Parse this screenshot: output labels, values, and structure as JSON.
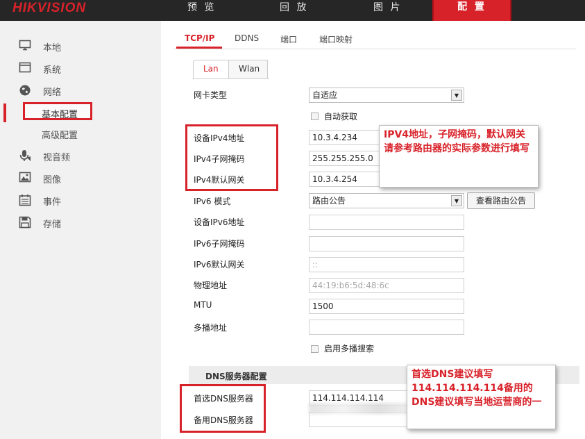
{
  "topbar": {
    "logo": "HIKVISION",
    "nav": [
      "预 览",
      "回 放",
      "图 片",
      "配 置"
    ]
  },
  "sidebar": {
    "items": [
      {
        "label": "本地",
        "icon": "monitor-icon"
      },
      {
        "label": "系统",
        "icon": "window-icon"
      },
      {
        "label": "网络",
        "icon": "globe-icon"
      },
      {
        "label": "基本配置",
        "icon": ""
      },
      {
        "label": "高级配置",
        "icon": ""
      },
      {
        "label": "视音频",
        "icon": "audio-video-icon"
      },
      {
        "label": "图像",
        "icon": "image-icon"
      },
      {
        "label": "事件",
        "icon": "calendar-icon"
      },
      {
        "label": "存储",
        "icon": "storage-icon"
      }
    ]
  },
  "tabs": [
    "TCP/IP",
    "DDNS",
    "端口",
    "端口映射"
  ],
  "subtabs": [
    "Lan",
    "Wlan"
  ],
  "form": {
    "nic_type": {
      "label": "网卡类型",
      "value": "自适应"
    },
    "auto_obtain": {
      "label": "自动获取"
    },
    "ipv4_addr": {
      "label": "设备IPv4地址",
      "value": "10.3.4.234"
    },
    "ipv4_mask": {
      "label": "IPv4子网掩码",
      "value": "255.255.255.0"
    },
    "ipv4_gateway": {
      "label": "IPv4默认网关",
      "value": "10.3.4.254"
    },
    "ipv6_mode": {
      "label": "IPv6 模式",
      "value": "路由公告",
      "button": "查看路由公告"
    },
    "ipv6_addr": {
      "label": "设备IPv6地址",
      "value": ""
    },
    "ipv6_mask": {
      "label": "IPv6子网掩码",
      "value": ""
    },
    "ipv6_gateway": {
      "label": "IPv6默认网关",
      "value": "::"
    },
    "mac": {
      "label": "物理地址",
      "value": "44:19:b6:5d:48:6c"
    },
    "mtu": {
      "label": "MTU",
      "value": "1500"
    },
    "multicast": {
      "label": "多播地址",
      "value": ""
    },
    "multicast_search": {
      "label": "启用多播搜索"
    }
  },
  "dns": {
    "section_title": "DNS服务器配置",
    "primary": {
      "label": "首选DNS服务器",
      "value": "114.114.114.114"
    },
    "secondary": {
      "label": "备用DNS服务器",
      "value": ""
    }
  },
  "annotations": {
    "ipv4_note": "IPV4地址，子网掩码，默认网关请参考路由器的实际参数进行填写",
    "dns_note": "首选DNS建议填写114.114.114.114备用的DNS建议填写当地运营商的一"
  },
  "colors": {
    "accent": "#d8222a",
    "topbar": "#262626",
    "sidebar": "#f1f1f1"
  }
}
